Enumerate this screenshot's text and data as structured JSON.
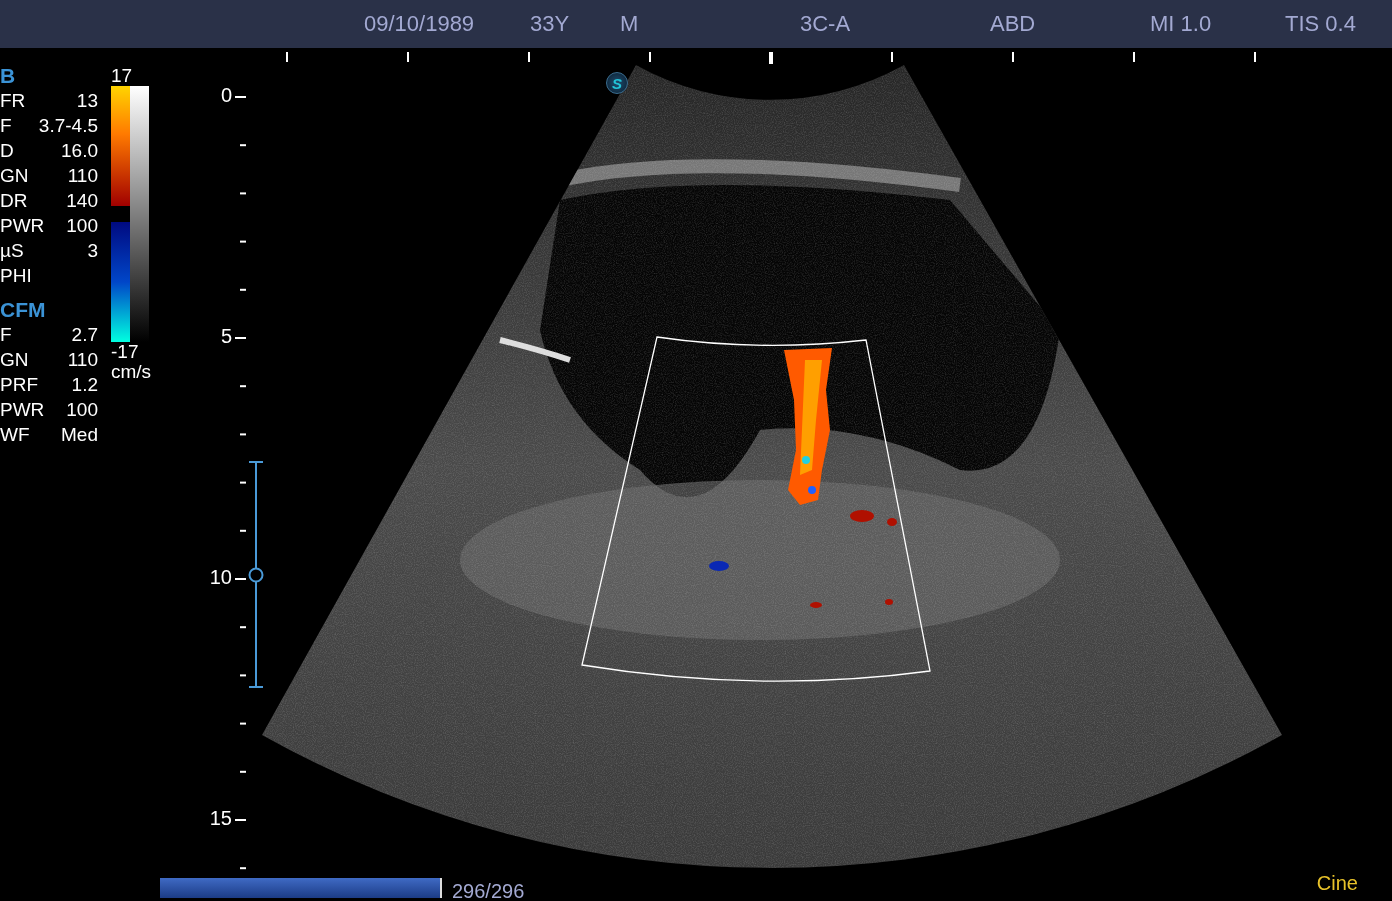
{
  "top_bar": {
    "date": "09/10/1989",
    "age": "33Y",
    "sex": "M",
    "probe": "3C-A",
    "preset": "ABD",
    "mi": "MI 1.0",
    "tis": "TIS 0.4"
  },
  "parameters": [
    {
      "title": "B",
      "rows": [
        {
          "label": "FR",
          "value": "13"
        },
        {
          "label": "F",
          "value": "3.7-4.5"
        },
        {
          "label": "D",
          "value": "16.0"
        },
        {
          "label": "GN",
          "value": "110"
        },
        {
          "label": "DR",
          "value": "140"
        },
        {
          "label": "PWR",
          "value": "100"
        },
        {
          "label": "µS",
          "value": "3"
        },
        {
          "label": "PHI"
        }
      ]
    },
    {
      "title": "CFM",
      "rows": [
        {
          "label": "F",
          "value": "2.7"
        },
        {
          "label": "GN",
          "value": "110"
        },
        {
          "label": "PRF",
          "value": "1.2"
        },
        {
          "label": "PWR",
          "value": "100"
        },
        {
          "label": "WF",
          "value": "Med"
        }
      ]
    }
  ],
  "color_scale": {
    "max": "17",
    "min": "-17",
    "unit": "cm/s"
  },
  "scan_badge": "S",
  "depth_labels": [
    "0",
    "5",
    "10",
    "15"
  ],
  "cine": {
    "level": 1,
    "counter": "296/296",
    "label": "Cine"
  }
}
